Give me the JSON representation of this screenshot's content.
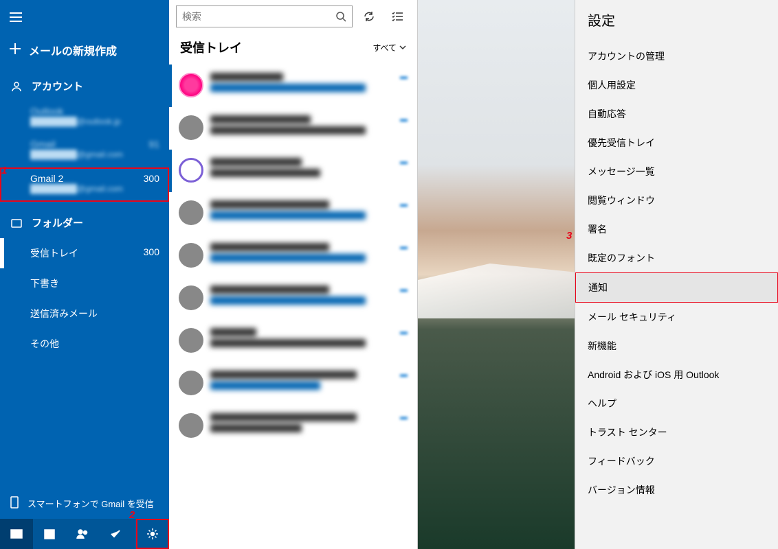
{
  "sidebar": {
    "new_mail": "メールの新規作成",
    "accounts_label": "アカウント",
    "accounts": [
      {
        "name": "Outlook",
        "email": "████████@outlook.jp",
        "count": ""
      },
      {
        "name": "Gmail",
        "email": "████████@gmail.com",
        "count": "91"
      },
      {
        "name": "Gmail 2",
        "email": "████████@gmail.com",
        "count": "300"
      }
    ],
    "folders_label": "フォルダー",
    "folders": [
      {
        "label": "受信トレイ",
        "count": "300",
        "selected": true
      },
      {
        "label": "下書き",
        "count": ""
      },
      {
        "label": "送信済みメール",
        "count": ""
      },
      {
        "label": "その他",
        "count": ""
      }
    ],
    "promo": "スマートフォンで Gmail を受信"
  },
  "search": {
    "placeholder": "検索"
  },
  "inbox": {
    "title": "受信トレイ",
    "filter": "すべて"
  },
  "settings": {
    "title": "設定",
    "items": [
      "アカウントの管理",
      "個人用設定",
      "自動応答",
      "優先受信トレイ",
      "メッセージ一覧",
      "閲覧ウィンドウ",
      "署名",
      "既定のフォント",
      "通知",
      "メール セキュリティ",
      "新機能",
      "Android および iOS 用 Outlook",
      "ヘルプ",
      "トラスト センター",
      "フィードバック",
      "バージョン情報"
    ],
    "highlight_index": 8
  },
  "callouts": {
    "one": "1",
    "two": "2",
    "three": "3"
  }
}
